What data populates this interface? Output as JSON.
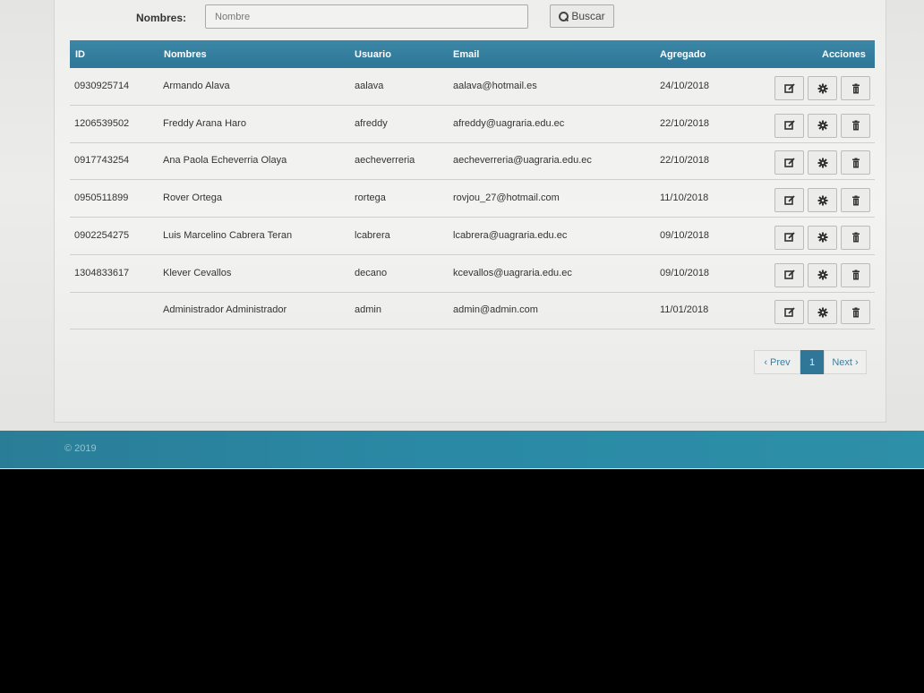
{
  "search": {
    "label": "Nombres:",
    "placeholder": "Nombre",
    "button_label": "Buscar"
  },
  "table": {
    "headers": {
      "id": "ID",
      "nombres": "Nombres",
      "usuario": "Usuario",
      "email": "Email",
      "agregado": "Agregado",
      "acciones": "Acciones"
    },
    "rows": [
      {
        "id": "0930925714",
        "nombres": "Armando Alava",
        "usuario": "aalava",
        "email": "aalava@hotmail.es",
        "agregado": "24/10/2018"
      },
      {
        "id": "1206539502",
        "nombres": "Freddy Arana Haro",
        "usuario": "afreddy",
        "email": "afreddy@uagraria.edu.ec",
        "agregado": "22/10/2018"
      },
      {
        "id": "0917743254",
        "nombres": "Ana Paola Echeverria Olaya",
        "usuario": "aecheverreria",
        "email": "aecheverreria@uagraria.edu.ec",
        "agregado": "22/10/2018"
      },
      {
        "id": "0950511899",
        "nombres": "Rover Ortega",
        "usuario": "rortega",
        "email": "rovjou_27@hotmail.com",
        "agregado": "11/10/2018"
      },
      {
        "id": "0902254275",
        "nombres": "Luis Marcelino Cabrera Teran",
        "usuario": "lcabrera",
        "email": "lcabrera@uagraria.edu.ec",
        "agregado": "09/10/2018"
      },
      {
        "id": "1304833617",
        "nombres": "Klever Cevallos",
        "usuario": "decano",
        "email": "kcevallos@uagraria.edu.ec",
        "agregado": "09/10/2018"
      },
      {
        "id": "",
        "nombres": "Administrador Administrador",
        "usuario": "admin",
        "email": "admin@admin.com",
        "agregado": "11/01/2018"
      }
    ],
    "action_icons": [
      "edit-icon",
      "gear-icon",
      "trash-icon"
    ]
  },
  "pagination": {
    "prev_label": "‹ Prev",
    "current_page": "1",
    "next_label": "Next ›"
  },
  "footer": {
    "copyright": "© 2019"
  },
  "colors": {
    "accent": "#2f7697",
    "footer": "#2a8aa6"
  }
}
